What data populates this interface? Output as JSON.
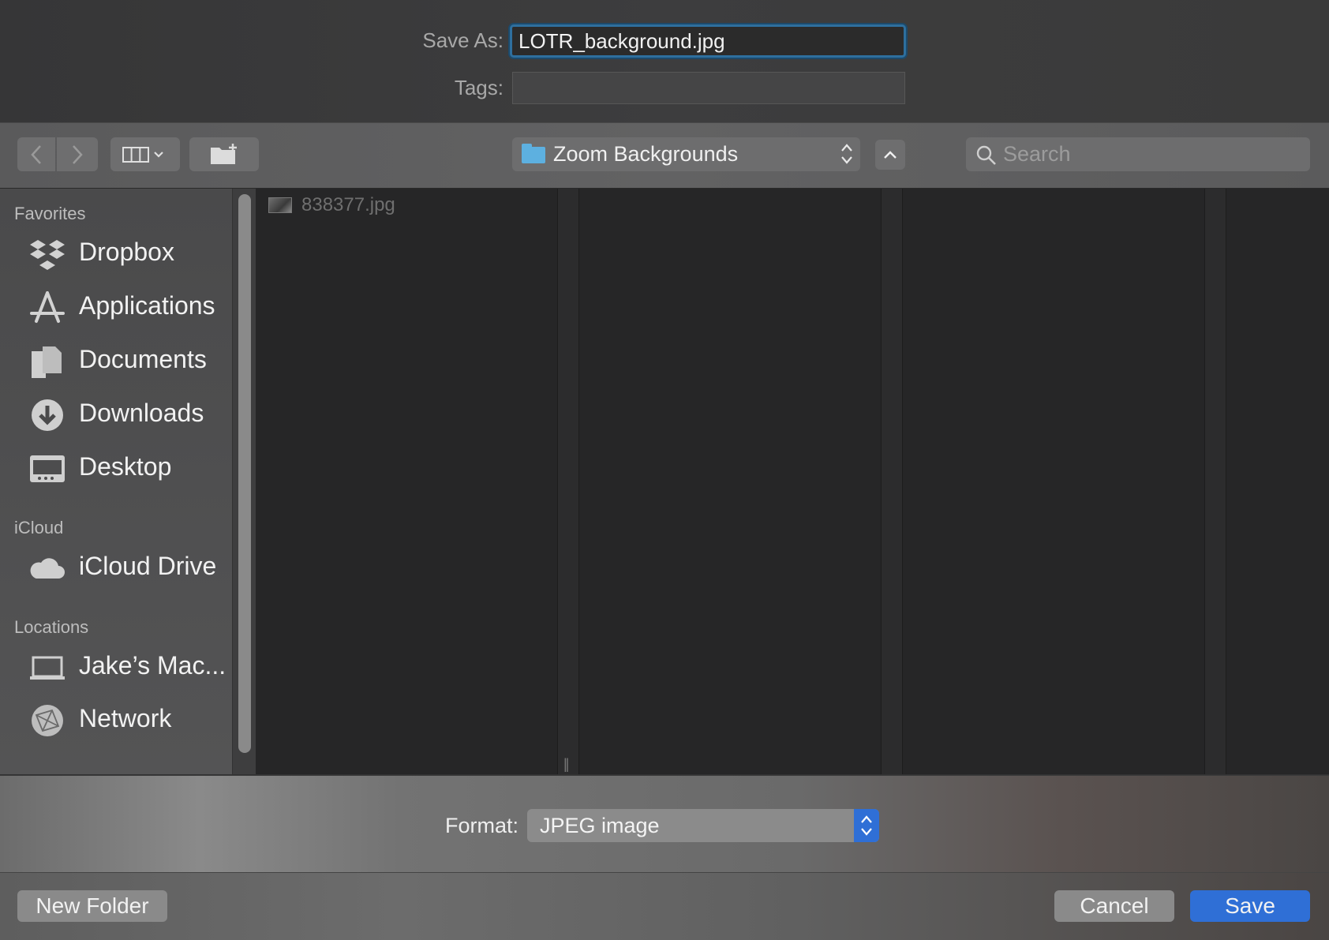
{
  "header": {
    "save_as_label": "Save As:",
    "save_as_value": "LOTR_background.jpg",
    "tags_label": "Tags:",
    "tags_value": ""
  },
  "toolbar": {
    "location": "Zoom Backgrounds",
    "search_placeholder": "Search"
  },
  "sidebar": {
    "sections": [
      {
        "title": "Favorites",
        "items": [
          {
            "label": "Dropbox",
            "icon": "dropbox-icon"
          },
          {
            "label": "Applications",
            "icon": "applications-icon"
          },
          {
            "label": "Documents",
            "icon": "documents-icon"
          },
          {
            "label": "Downloads",
            "icon": "downloads-icon"
          },
          {
            "label": "Desktop",
            "icon": "desktop-icon"
          }
        ]
      },
      {
        "title": "iCloud",
        "items": [
          {
            "label": "iCloud Drive",
            "icon": "cloud-icon"
          }
        ]
      },
      {
        "title": "Locations",
        "items": [
          {
            "label": "Jake’s Mac...",
            "icon": "laptop-icon"
          },
          {
            "label": "Network",
            "icon": "network-icon"
          }
        ]
      }
    ]
  },
  "browser": {
    "files": [
      {
        "name": "838377.jpg"
      }
    ]
  },
  "format": {
    "label": "Format:",
    "value": "JPEG image"
  },
  "buttons": {
    "new_folder": "New Folder",
    "cancel": "Cancel",
    "save": "Save"
  },
  "colors": {
    "accent": "#2f6fd6",
    "focus_ring": "#2e6f9e",
    "folder": "#5db0e0"
  }
}
